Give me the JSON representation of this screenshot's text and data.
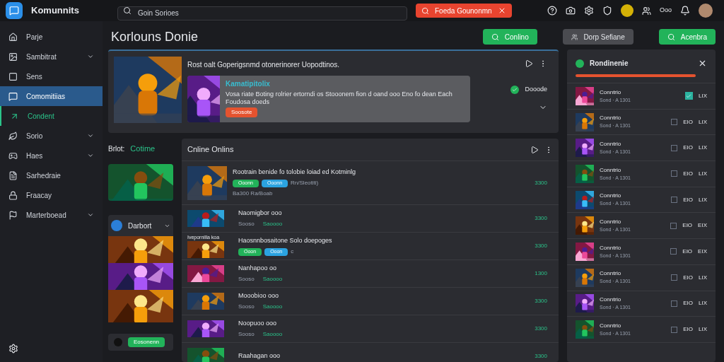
{
  "app": {
    "name": "Komunnits"
  },
  "search": {
    "placeholder": "Goin Sorioes"
  },
  "alert": {
    "text": "Foeda Gounonmn"
  },
  "header_text": "Ooo",
  "sidebar": {
    "items": [
      {
        "label": "Parje",
        "selected": false,
        "chevron": false
      },
      {
        "label": "Sambitrat",
        "selected": false,
        "chevron": true
      },
      {
        "label": "Sens",
        "selected": false,
        "chevron": false
      },
      {
        "label": "Comomitiias",
        "selected": true,
        "chevron": false
      },
      {
        "label": "Condent",
        "selected": false,
        "chevron": false,
        "active": true
      },
      {
        "label": "Sorio",
        "selected": false,
        "chevron": true
      },
      {
        "label": "Haes",
        "selected": false,
        "chevron": true
      },
      {
        "label": "Sarhedraie",
        "selected": false,
        "chevron": false
      },
      {
        "label": "Fraacay",
        "selected": false,
        "chevron": false
      },
      {
        "label": "Marterboead",
        "selected": false,
        "chevron": true
      }
    ]
  },
  "page": {
    "title": "Korlouns Donie",
    "buttons": [
      {
        "label": "Conlino",
        "kind": "primary"
      },
      {
        "label": "Dorp Sefiane",
        "kind": "secondary"
      },
      {
        "label": "Acenbra",
        "kind": "primary"
      }
    ]
  },
  "featured": {
    "headline": "Rost oalt Goperigsnmd otonerinorer Uopodtinos.",
    "item": {
      "title": "Kamatipitolix",
      "text": "Vosa riate Boting rolrier ertorndi os Stooonem fion d oand ooo Eno fo dean Each Foudosa doeds",
      "button": "Soosote"
    },
    "status": {
      "label": "Dooode",
      "checked": true
    }
  },
  "left_column": {
    "label": "Brlot:",
    "highlight": "Cotime",
    "group": {
      "title": "Darbort"
    },
    "button": "Eosonenn"
  },
  "online": {
    "title": "Cnline Onlins",
    "rows": [
      {
        "kind": "featured",
        "title": "Rootrain benide fo tolobie loiad ed Kotminlg",
        "tags": [
          "Ooonn",
          "Ooonn"
        ],
        "note": "Rn/Sleotiti)",
        "meta": "Ba300 Ra/Boab",
        "value": "3300"
      },
      {
        "kind": "simple",
        "title": "Naomigbor ooo",
        "meta": "Sooso",
        "status": "Saoooo",
        "value": "3300"
      },
      {
        "kind": "tagged",
        "caption": "Ivepornilla koa",
        "title": "Haosnnbosaitone Solo doepoges",
        "tags": [
          "Ooon",
          "Ooon"
        ],
        "note": "c",
        "value": "3300"
      },
      {
        "kind": "simple",
        "title": "Nanhapoo oo",
        "meta": "Sooso",
        "status": "Saoooo",
        "value": "1300"
      },
      {
        "kind": "simple",
        "title": "Mooobioo ooo",
        "meta": "Sooso",
        "status": "Saoooo",
        "value": "3300"
      },
      {
        "kind": "simple",
        "title": "Noopuoo ooo",
        "meta": "Sooso",
        "status": "Saoooo",
        "value": "3300"
      },
      {
        "kind": "simple",
        "title": "Raahagan ooo",
        "value": "3300"
      }
    ]
  },
  "panel": {
    "title": "Rondinenie",
    "rows": [
      {
        "title": "Conntrio",
        "meta": "Sond · A 1301",
        "checked": true,
        "value": "LIX"
      },
      {
        "title": "Conntrio",
        "meta": "Sond · A 1301",
        "checked": false,
        "tag": "EIO",
        "value": "LIX"
      },
      {
        "title": "Conntrio",
        "meta": "Sond · A 1301",
        "checked": false,
        "tag": "EIO",
        "value": "LIX"
      },
      {
        "title": "Conntrio",
        "meta": "Sond · A 1301",
        "checked": false,
        "tag": "EIO",
        "value": "LIX"
      },
      {
        "title": "Conntrio",
        "meta": "Sond · A 1301",
        "checked": false,
        "tag": "EIO",
        "value": "LIX"
      },
      {
        "title": "Conntrio",
        "meta": "Sond · A 1301",
        "checked": false,
        "tag": "EIO",
        "value": "EIX"
      },
      {
        "title": "Conntrio",
        "meta": "Sond · A 1301",
        "checked": false,
        "tag": "EIO",
        "value": "EIX"
      },
      {
        "title": "Conntrio",
        "meta": "Sond · A 1301",
        "checked": false,
        "tag": "EIO",
        "value": "LIX"
      },
      {
        "title": "Conntrio",
        "meta": "Sond · A 1301",
        "checked": false,
        "tag": "EIO",
        "value": "LIX"
      },
      {
        "title": "Conntrio",
        "meta": "Sond · A 1301",
        "checked": false,
        "tag": "EIO",
        "value": "LIX"
      }
    ]
  }
}
